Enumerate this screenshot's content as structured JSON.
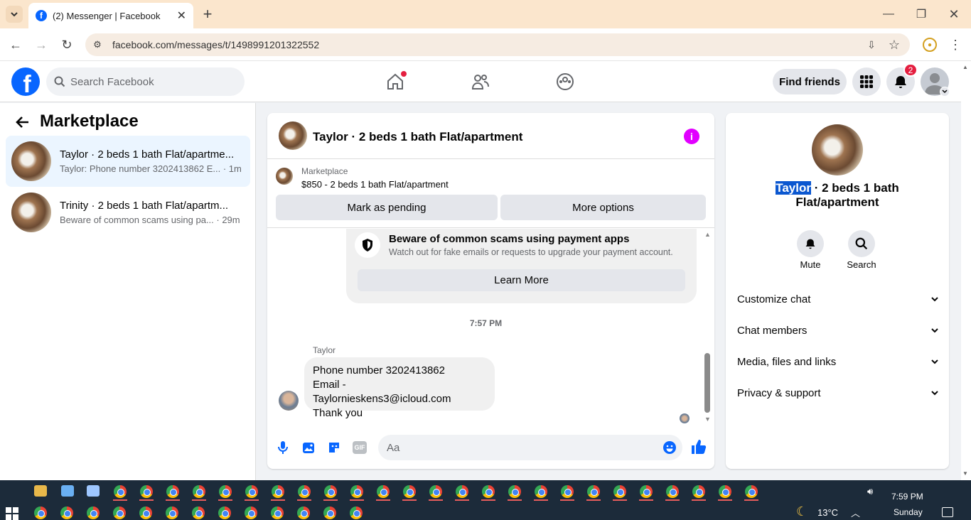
{
  "browser": {
    "tab_title": "(2) Messenger | Facebook",
    "url": "facebook.com/messages/t/1498991201322552"
  },
  "header": {
    "search_placeholder": "Search Facebook",
    "find_friends": "Find friends",
    "notif_count": "2"
  },
  "sidebar": {
    "title": "Marketplace",
    "threads": [
      {
        "name": "Taylor · 2 beds 1 bath Flat/apartme...",
        "preview": "Taylor: Phone number 3202413862 E...",
        "time": "· 1m"
      },
      {
        "name": "Trinity · 2 beds 1 bath Flat/apartm...",
        "preview": "Beware of common scams using pa...",
        "time": "· 29m"
      }
    ]
  },
  "chat": {
    "title": "Taylor · 2 beds 1 bath Flat/apartment",
    "listing_label": "Marketplace",
    "listing_price": "$850 - 2 beds 1 bath Flat/apartment",
    "mark_pending": "Mark as pending",
    "more_options": "More options",
    "warning_title": "Beware of common scams using payment apps",
    "warning_body": "Watch out for fake emails or requests to upgrade your payment account.",
    "learn_more": "Learn More",
    "timestamp": "7:57 PM",
    "sender": "Taylor",
    "message_lines": [
      "Phone number 3202413862",
      "Email - Taylornieskens3@icloud.com",
      "Thank you"
    ],
    "input_placeholder": "Aa"
  },
  "details": {
    "name_highlight": "Taylor",
    "name_rest": " · 2 beds 1 bath",
    "name_line2": "Flat/apartment",
    "mute": "Mute",
    "search": "Search",
    "sections": [
      "Customize chat",
      "Chat members",
      "Media, files and links",
      "Privacy & support"
    ]
  },
  "taskbar": {
    "temperature": "13°C",
    "time": "7:59 PM",
    "day": "Sunday"
  },
  "colors": {
    "fb_blue": "#0866ff",
    "accent_magenta": "#e100ff",
    "notif_red": "#e41e3f"
  }
}
